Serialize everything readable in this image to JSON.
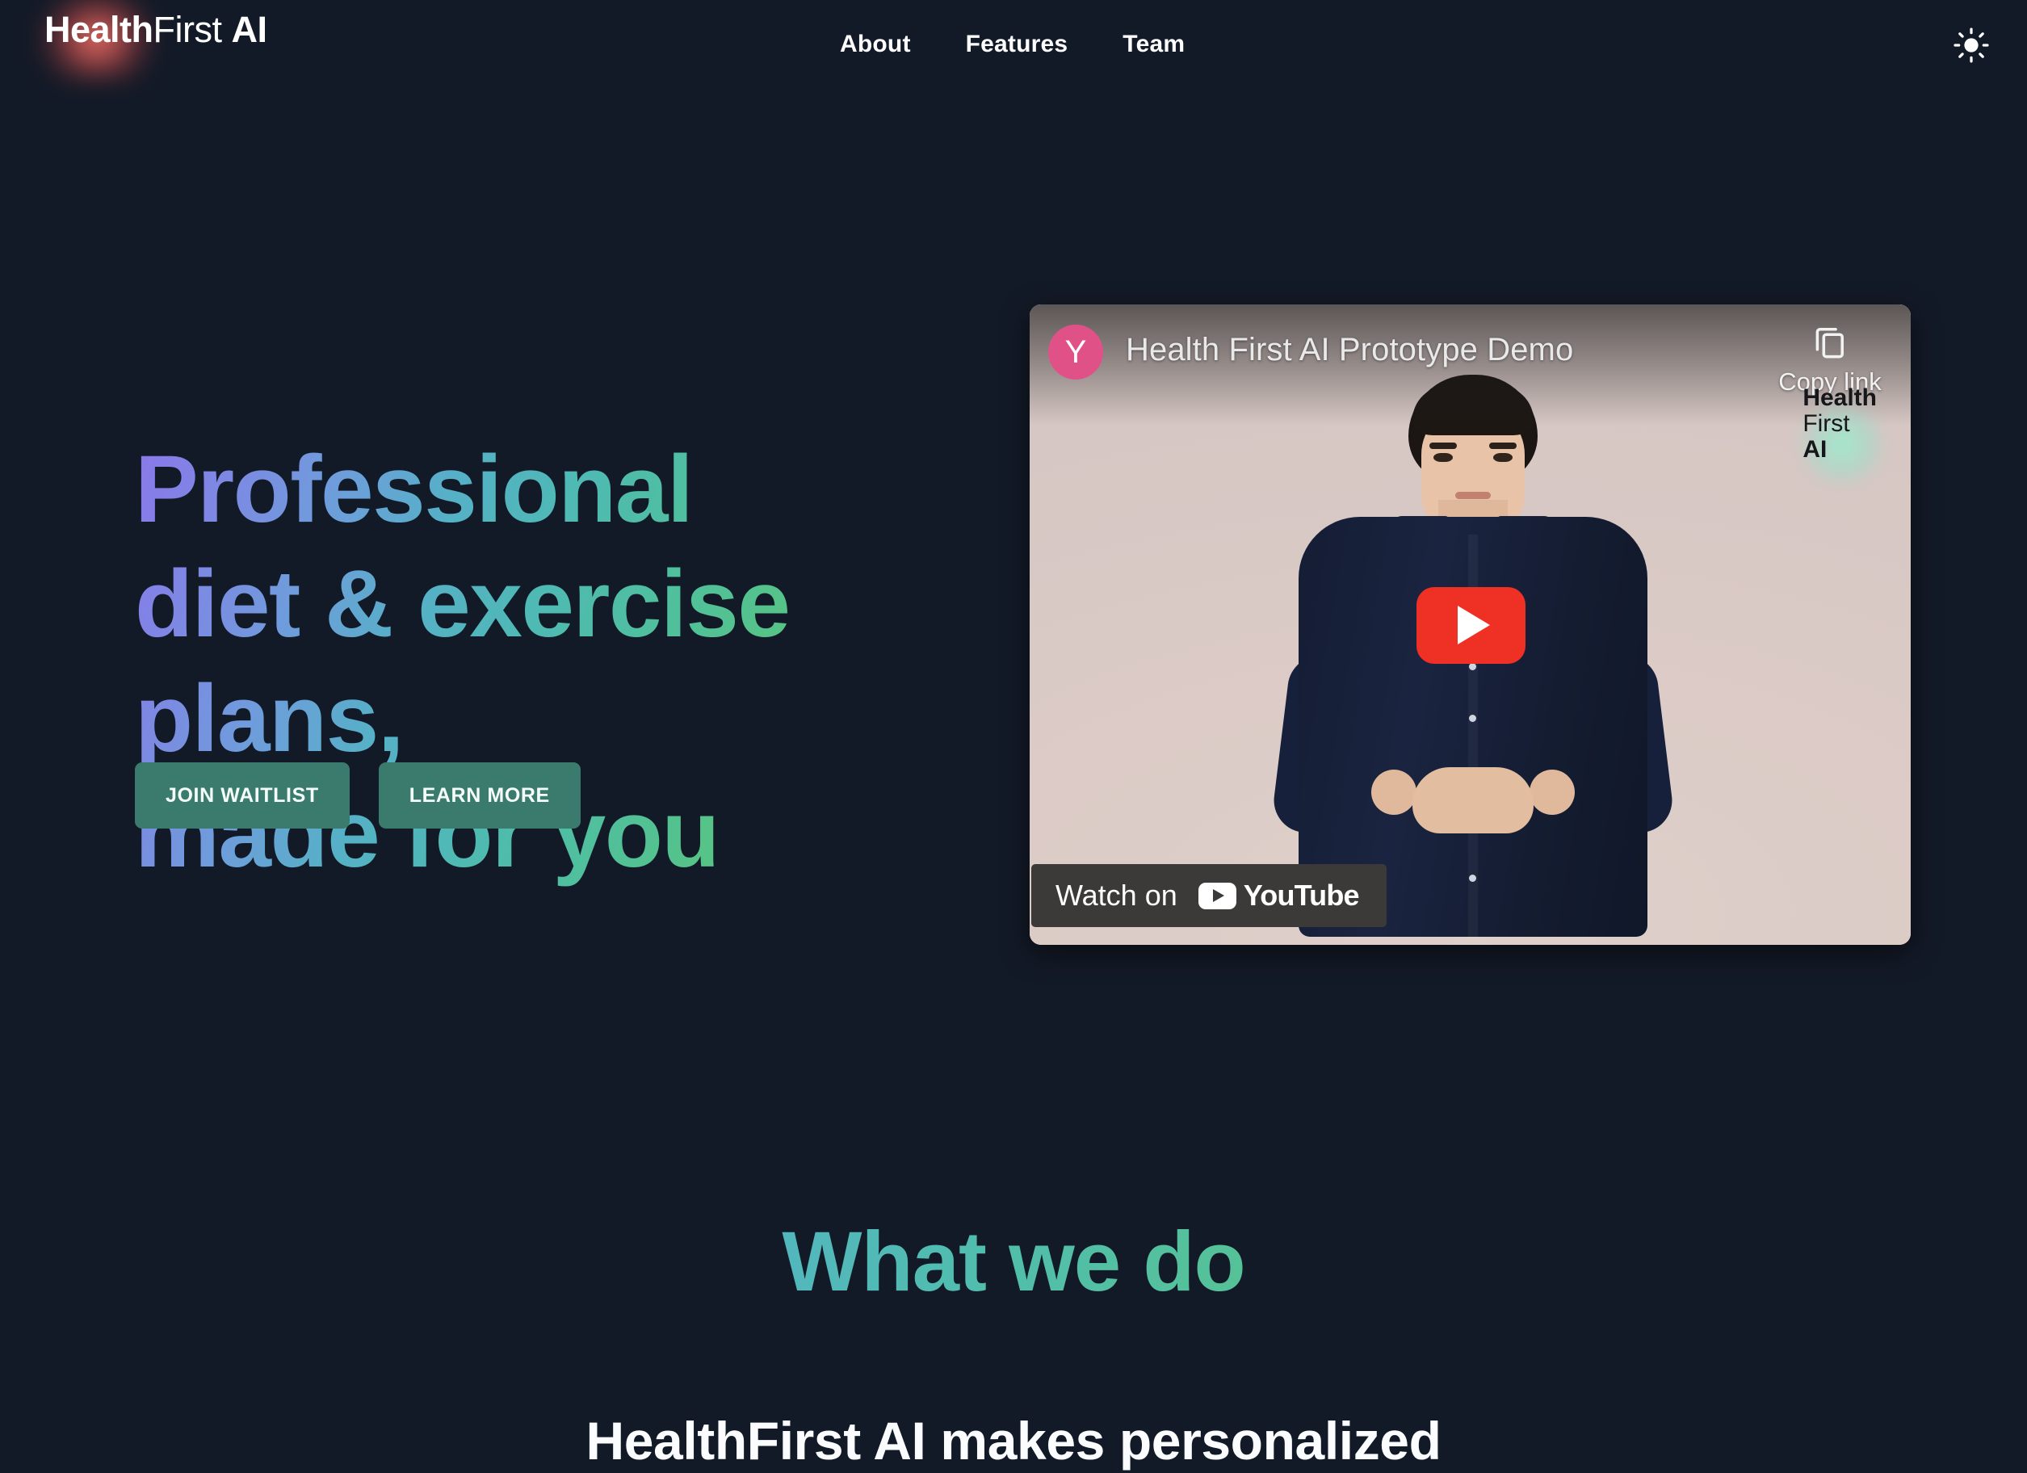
{
  "brand": {
    "name_bold1": "Health",
    "name_light": "First",
    "name_bold2": "AI"
  },
  "nav": {
    "links": [
      {
        "label": "About"
      },
      {
        "label": "Features"
      },
      {
        "label": "Team"
      }
    ],
    "theme_toggle_icon": "sun-icon"
  },
  "hero": {
    "headline_line1": "Professional",
    "headline_line2": "diet & exercise plans,",
    "headline_line3": "made for you",
    "gradient_start": "#8a78ea",
    "gradient_mid": "#4fbfa0",
    "gradient_end": "#66bd6c",
    "buttons": [
      {
        "label": "JOIN WAITLIST",
        "color": "#3b7b6e"
      },
      {
        "label": "LEARN MORE",
        "color": "#3b7b6e"
      }
    ]
  },
  "video": {
    "channel_initial": "Y",
    "channel_avatar_color": "#e05287",
    "title": "Health First AI Prototype Demo",
    "copy_link_label": "Copy link",
    "copy_link_icon": "copy-icon",
    "play_icon": "play-icon",
    "play_button_color": "#ee3124",
    "watermark_line1": "Health",
    "watermark_line2": "First",
    "watermark_line3": "AI",
    "watch_on_label": "Watch on",
    "youtube_label": "YouTube"
  },
  "section_what": {
    "title": "What we do",
    "subtitle": "HealthFirst AI makes personalized"
  },
  "theme": {
    "page_background": "#131a27",
    "text_primary": "#fbfcfe"
  }
}
